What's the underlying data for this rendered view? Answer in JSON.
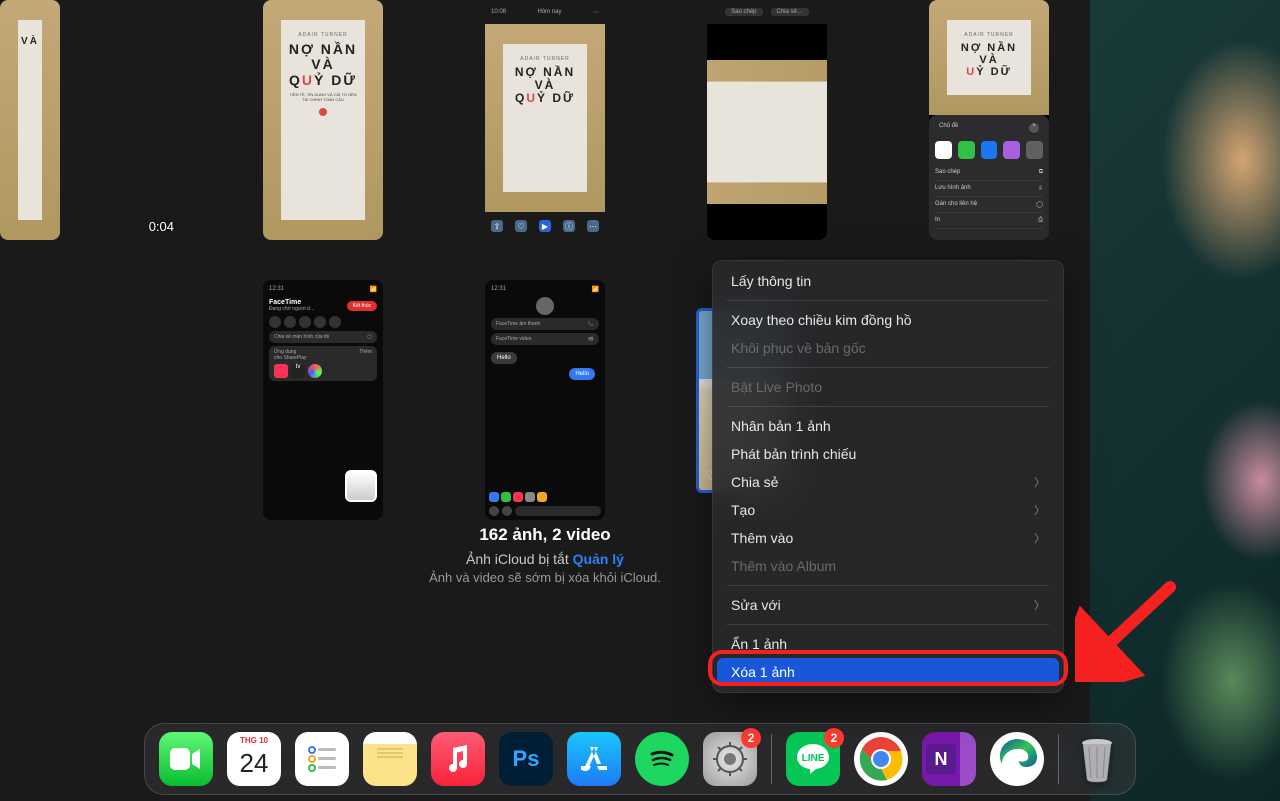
{
  "book": {
    "author": "ADAIR TURNER",
    "title_l1": "NỢ NẦN",
    "title_l2": "VÀ",
    "title_l3_pre": "Q",
    "title_l3_accent": "U",
    "title_l3_post": "Ỷ DỮ",
    "subtitle": "TIỀN TỆ, TÍN DỤNG VÀ CẢI TỔ NỀN TÀI CHÍNH TOÀN CẦU"
  },
  "thumbs": {
    "duration_1": "0:04",
    "phone_edit": {
      "top_left": "10:08",
      "top_center": "Hôm nay",
      "bar_icons": [
        "⇧",
        "♡",
        "▶",
        "ⓘ",
        "⋯"
      ]
    },
    "phone_safari": {
      "top_buttons": [
        "Sao chép",
        "Chia sẻ…"
      ]
    },
    "phone_share": {
      "header": "Chủ đề",
      "row_icons": [
        "#30c048",
        "#30c048",
        "#1878f0",
        "#a860e0",
        "#606060"
      ],
      "items": [
        "Sao chép",
        "Lưu hình ảnh",
        "Gán cho liên hệ",
        "In"
      ]
    },
    "facetime": {
      "time": "12:31",
      "app": "FaceTime",
      "status": "Đang chờ người d…",
      "end": "Kết thúc",
      "pill1": "Chia sẻ màn hình của tôi",
      "pill2_t": "Ứng dụng",
      "pill2_s": "cho SharePlay",
      "more": "Thêm"
    },
    "imessage": {
      "time": "12:31",
      "name": "FaceTime âm thanh",
      "sub": "FaceTime video",
      "msg": "Hello",
      "msg2": "Hello"
    }
  },
  "footer": {
    "count": "162 ảnh, 2 video",
    "line1_a": "Ảnh iCloud bị tắt ",
    "line1_link": "Quản lý",
    "line2": "Ảnh và video sẽ sớm bị xóa khỏi iCloud."
  },
  "ctx": {
    "get_info": "Lấy thông tin",
    "rotate": "Xoay theo chiều kim đồng hồ",
    "revert": "Khôi phục về bản gốc",
    "live": "Bật Live Photo",
    "dup": "Nhân bản 1 ảnh",
    "slideshow": "Phát bản trình chiếu",
    "share": "Chia sẻ",
    "create": "Tạo",
    "add_to": "Thêm vào",
    "add_album": "Thêm vào Album",
    "edit_with": "Sửa với",
    "hide": "Ẩn 1 ảnh",
    "delete": "Xóa 1 ảnh"
  },
  "dock": {
    "cal_month": "THG 10",
    "cal_day": "24",
    "badge_settings": "2",
    "badge_line": "2",
    "apps": {
      "facetime": "FaceTime",
      "calendar": "Calendar",
      "reminders": "Reminders",
      "notes": "Notes",
      "music": "Music",
      "photoshop": "Photoshop",
      "appstore": "App Store",
      "spotify": "Spotify",
      "settings": "Settings",
      "line": "LINE",
      "chrome": "Chrome",
      "onenote": "OneNote",
      "edge": "Edge",
      "trash": "Trash"
    }
  }
}
